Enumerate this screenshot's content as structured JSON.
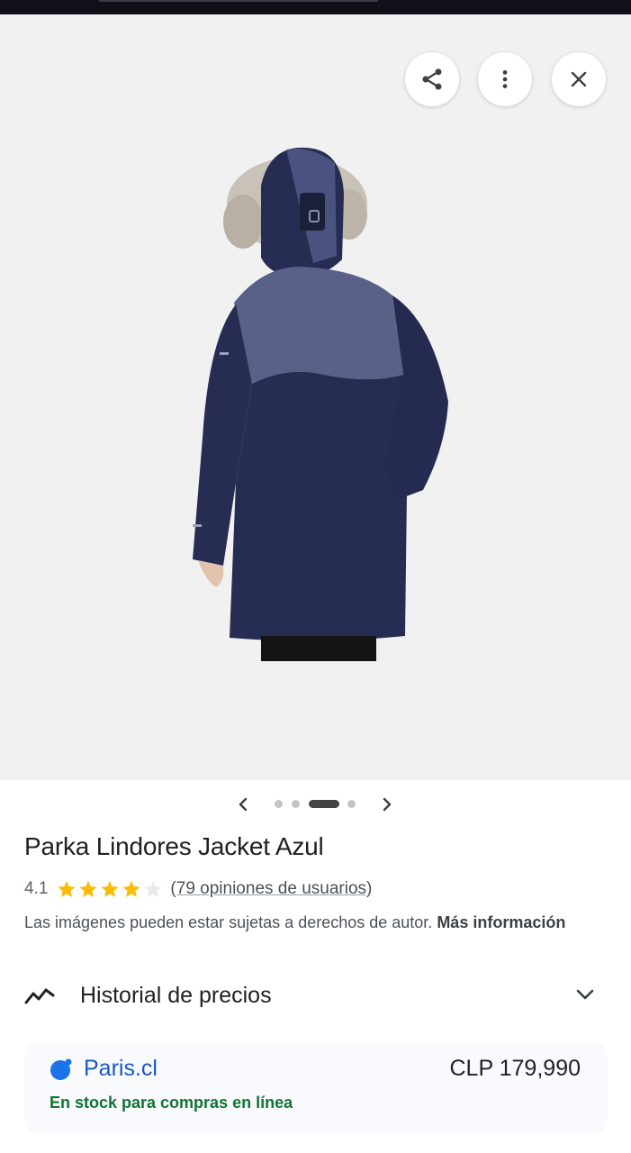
{
  "toolbar": {
    "share_icon": "share-icon",
    "more_icon": "more-vert-icon",
    "close_icon": "close-icon"
  },
  "gallery": {
    "image_description_icon": "parka-jacket-back-view",
    "total_images": 4,
    "active_index": 2
  },
  "product": {
    "title": "Parka Lindores Jacket Azul",
    "rating": "4.1",
    "rating_value": 4.1,
    "rating_max": 5,
    "reviews_link": "(79 opiniones de usuarios)",
    "copyright_text": "Las imágenes pueden estar sujetas a derechos de autor. ",
    "more_info_link": "Más información"
  },
  "price_history": {
    "label": "Historial de precios",
    "icon": "trend-line-icon",
    "chevron_icon": "chevron-down-icon"
  },
  "offer": {
    "merchant": "Paris.cl",
    "merchant_icon": "paris-logo-icon",
    "price": "CLP 179,990",
    "stock": "En stock para compras en línea"
  },
  "colors": {
    "star": "#fbbc04",
    "star_empty": "#dadce0",
    "merchant_link": "#1a56c7",
    "stock_green": "#137333",
    "jacket_navy": "#262c52"
  }
}
